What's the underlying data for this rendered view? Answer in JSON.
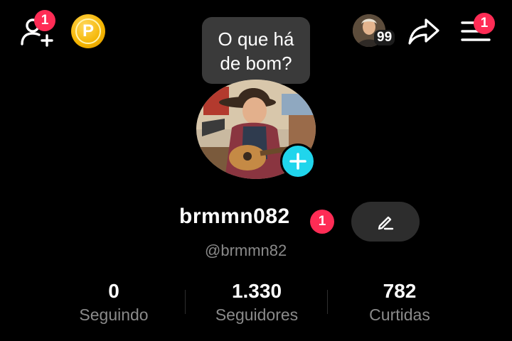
{
  "header": {
    "add_friend_badge": "1",
    "coin_letter": "P",
    "viewers_count": "99",
    "menu_badge": "1"
  },
  "tooltip": {
    "text_line1": "O que há",
    "text_line2": "de bom?"
  },
  "profile": {
    "username": "brmmn082",
    "username_badge": "1",
    "handle": "@brmmn82"
  },
  "stats": [
    {
      "value": "0",
      "label": "Seguindo"
    },
    {
      "value": "1.330",
      "label": "Seguidores"
    },
    {
      "value": "782",
      "label": "Curtidas"
    }
  ],
  "colors": {
    "badge": "#ff2c55",
    "plus": "#20d5ec",
    "coin": "#f4b400"
  },
  "icons": {
    "add_friend": "person-plus-icon",
    "coin": "coin-icon",
    "share": "share-arrow-icon",
    "menu": "hamburger-icon",
    "edit": "pencil-icon",
    "add_avatar": "plus-icon"
  }
}
